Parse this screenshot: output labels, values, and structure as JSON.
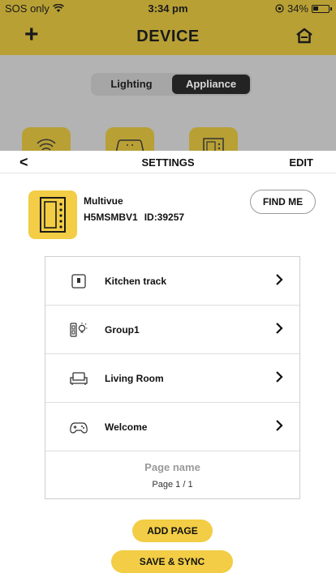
{
  "status_bar": {
    "carrier": "SOS only",
    "time": "3:34 pm",
    "battery": "34%"
  },
  "app_header": {
    "title": "DEVICE",
    "add_symbol": "+"
  },
  "segments": {
    "lighting": "Lighting",
    "appliance": "Appliance",
    "selected": "Appliance"
  },
  "settings": {
    "title": "SETTINGS",
    "back_symbol": "<",
    "edit_label": "EDIT",
    "device": {
      "name": "Multivue",
      "model": "H5MSMBV1",
      "id_label": "ID:39257",
      "icon": "keypad-icon"
    },
    "find_me_label": "FIND ME",
    "rows": [
      {
        "label": "Kitchen track",
        "icon": "switch-icon"
      },
      {
        "label": "Group1",
        "icon": "group-bulb-icon"
      },
      {
        "label": "Living Room",
        "icon": "sofa-icon"
      },
      {
        "label": "Welcome",
        "icon": "gamepad-icon"
      }
    ],
    "page_name": "Page name",
    "page_number": "Page 1 / 1",
    "add_page_label": "ADD PAGE",
    "save_sync_label": "SAVE & SYNC"
  },
  "colors": {
    "accent": "#f2cd45",
    "header_dimmed": "#b8a035",
    "overlay": "#b3b3b3"
  }
}
